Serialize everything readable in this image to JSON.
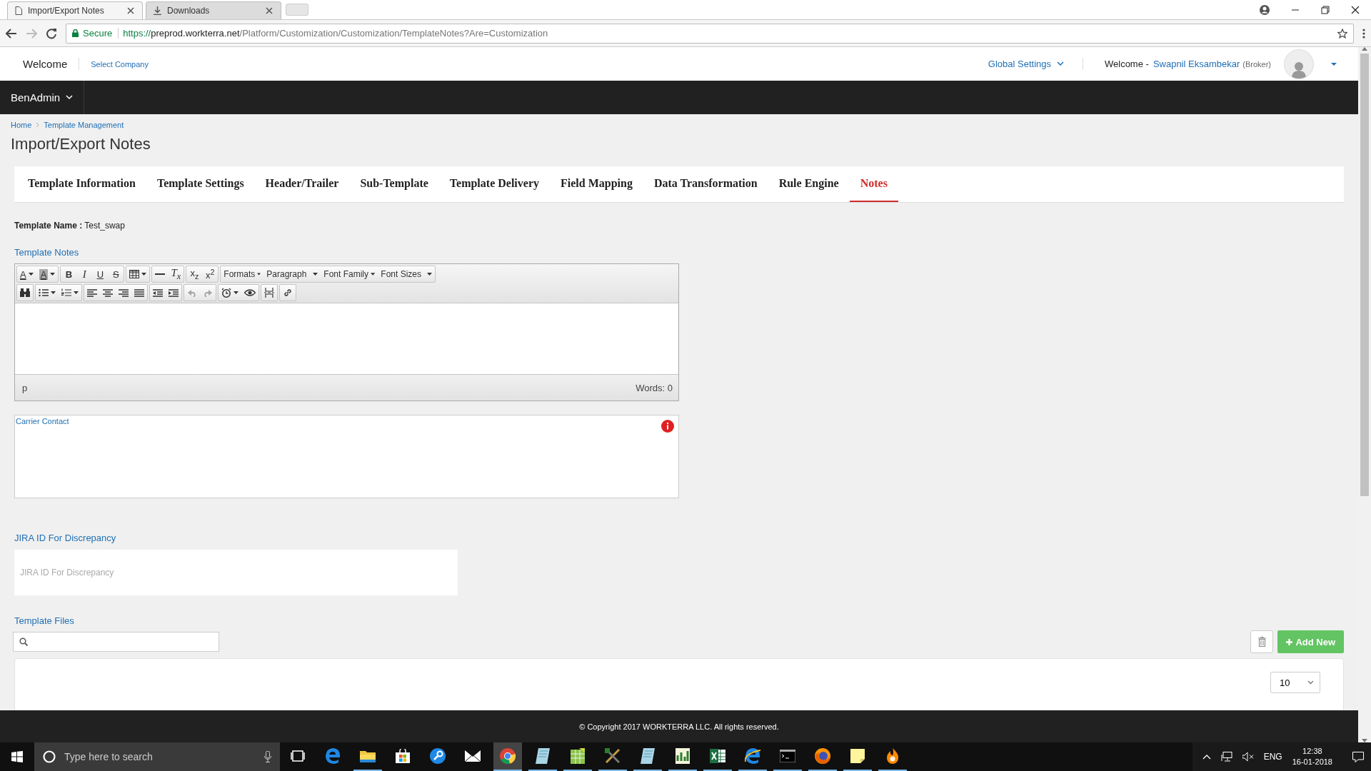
{
  "browser": {
    "tabs": [
      {
        "title": "Import/Export Notes",
        "selected": true
      },
      {
        "title": "Downloads",
        "selected": false
      }
    ],
    "secure_label": "Secure",
    "url": {
      "scheme": "https://",
      "host": "preprod.workterra.net",
      "path": "/Platform/Customization/Customization/TemplateNotes?Are=Customization"
    }
  },
  "header": {
    "welcome": "Welcome",
    "select_company": "Select Company",
    "global_settings": "Global Settings",
    "user_greeting": "Welcome -",
    "user_name": "Swapnil Eksambekar",
    "user_role": "(Broker)"
  },
  "nav": {
    "menu": "BenAdmin"
  },
  "breadcrumb": [
    "Home",
    "Template Management"
  ],
  "title": "Import/Export Notes",
  "tabs": [
    {
      "label": "Template Information",
      "selected": false
    },
    {
      "label": "Template Settings",
      "selected": false
    },
    {
      "label": "Header/Trailer",
      "selected": false
    },
    {
      "label": "Sub-Template",
      "selected": false
    },
    {
      "label": "Template Delivery",
      "selected": false
    },
    {
      "label": "Field Mapping",
      "selected": false
    },
    {
      "label": "Data Transformation",
      "selected": false
    },
    {
      "label": "Rule Engine",
      "selected": false
    },
    {
      "label": "Notes",
      "selected": true
    }
  ],
  "template_name": {
    "label": "Template Name :",
    "value": "Test_swap"
  },
  "template_notes": {
    "label": "Template Notes",
    "toolbar": [
      [
        [
          {
            "kind": "forecolor",
            "text": "A",
            "split": true,
            "disabled": false
          },
          {
            "kind": "backcolor",
            "text": "A",
            "split": true,
            "disabled": false
          }
        ],
        [
          {
            "kind": "bold",
            "text": "B",
            "split": false,
            "disabled": false
          },
          {
            "kind": "italic",
            "text": "I",
            "split": false,
            "disabled": false
          },
          {
            "kind": "underline",
            "text": "U",
            "split": false,
            "disabled": false
          },
          {
            "kind": "strike",
            "text": "S",
            "split": false,
            "disabled": false
          }
        ],
        [
          {
            "kind": "table",
            "split": true,
            "disabled": false
          }
        ],
        [
          {
            "kind": "hr",
            "split": false,
            "disabled": false
          },
          {
            "kind": "clear",
            "text": "T$_{x}$",
            "split": false,
            "disabled": false
          }
        ],
        [
          {
            "kind": "sub",
            "text": "x$_{z}$",
            "split": false,
            "disabled": false
          },
          {
            "kind": "sup",
            "text": "x$^{2}$",
            "split": false,
            "disabled": false
          }
        ],
        [
          {
            "kind": "menu",
            "text": "Formats",
            "split": true,
            "disabled": false
          },
          {
            "kind": "menu",
            "text": "Paragraph",
            "split": true,
            "disabled": false
          },
          {
            "kind": "menu",
            "text": "Font Family",
            "split": true,
            "disabled": false
          },
          {
            "kind": "menu",
            "text": "Font Sizes",
            "split": true,
            "disabled": false
          }
        ]
      ],
      [
        [
          {
            "kind": "find",
            "split": false,
            "disabled": false
          }
        ],
        [
          {
            "kind": "bullist",
            "split": true,
            "disabled": false
          },
          {
            "kind": "numlist",
            "split": true,
            "disabled": false
          }
        ],
        [
          {
            "kind": "alignleft",
            "split": false,
            "disabled": false
          },
          {
            "kind": "aligncenter",
            "split": false,
            "disabled": false
          },
          {
            "kind": "alignright",
            "split": false,
            "disabled": false
          },
          {
            "kind": "justify",
            "split": false,
            "disabled": false
          }
        ],
        [
          {
            "kind": "outdent",
            "split": false,
            "disabled": false
          },
          {
            "kind": "indent",
            "split": false,
            "disabled": false
          }
        ],
        [
          {
            "kind": "undo",
            "split": false,
            "disabled": true
          },
          {
            "kind": "redo",
            "split": false,
            "disabled": true
          }
        ],
        [
          {
            "kind": "clock",
            "split": true,
            "disabled": false
          },
          {
            "kind": "preview",
            "split": false,
            "disabled": false
          }
        ],
        [
          {
            "kind": "pagebreak",
            "split": false,
            "disabled": false
          }
        ],
        [
          {
            "kind": "link",
            "split": false,
            "disabled": false
          }
        ]
      ]
    ],
    "path": "p",
    "word_count": "Words: 0"
  },
  "carrier_contact": {
    "label": "Carrier Contact"
  },
  "jira": {
    "label": "JIRA ID For Discrepancy",
    "placeholder": "JIRA ID For Discrepancy"
  },
  "template_files": {
    "label": "Template Files",
    "add_button": "Add New",
    "page_size": "10"
  },
  "footer": "© Copyright 2017 WORKTERRA LLC. All rights reserved.",
  "taskbar": {
    "search_placeholder": "Type here to search",
    "apps": [
      {
        "kind": "taskview",
        "running": false,
        "selected": false
      },
      {
        "kind": "edge",
        "running": false,
        "selected": false
      },
      {
        "kind": "folder",
        "running": true,
        "selected": false
      },
      {
        "kind": "store",
        "running": false,
        "selected": false
      },
      {
        "kind": "wrench",
        "running": false,
        "selected": false
      },
      {
        "kind": "mail",
        "running": false,
        "selected": false
      },
      {
        "kind": "chrome",
        "running": true,
        "selected": true
      },
      {
        "kind": "notebook",
        "running": true,
        "selected": false
      },
      {
        "kind": "sheet",
        "running": true,
        "selected": false
      },
      {
        "kind": "tools",
        "running": true,
        "selected": false
      },
      {
        "kind": "notebook",
        "running": true,
        "selected": false
      },
      {
        "kind": "chart",
        "running": true,
        "selected": false
      },
      {
        "kind": "excel",
        "running": true,
        "selected": false
      },
      {
        "kind": "ie",
        "running": true,
        "selected": false
      },
      {
        "kind": "terminal",
        "running": true,
        "selected": false
      },
      {
        "kind": "firefox",
        "running": true,
        "selected": false
      },
      {
        "kind": "note",
        "running": true,
        "selected": false
      },
      {
        "kind": "flame",
        "running": true,
        "selected": false
      }
    ],
    "language": "ENG",
    "time": "12:38",
    "date": "16-01-2018"
  }
}
